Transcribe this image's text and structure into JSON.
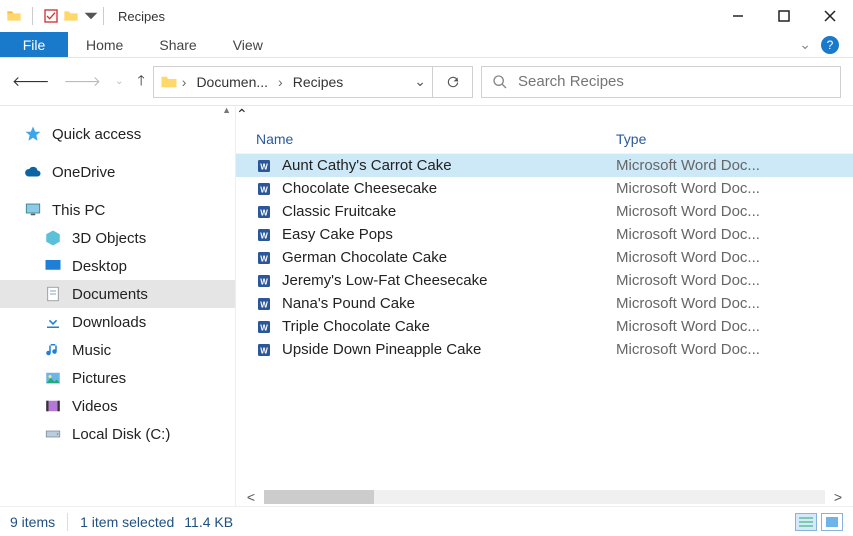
{
  "window": {
    "title": "Recipes"
  },
  "ribbon": {
    "file": "File",
    "tabs": [
      "Home",
      "Share",
      "View"
    ]
  },
  "address": {
    "segments": [
      "Documen...",
      "Recipes"
    ]
  },
  "search": {
    "placeholder": "Search Recipes"
  },
  "nav": {
    "quick_access": "Quick access",
    "onedrive": "OneDrive",
    "this_pc": "This PC",
    "items": [
      {
        "label": "3D Objects"
      },
      {
        "label": "Desktop"
      },
      {
        "label": "Documents"
      },
      {
        "label": "Downloads"
      },
      {
        "label": "Music"
      },
      {
        "label": "Pictures"
      },
      {
        "label": "Videos"
      },
      {
        "label": "Local Disk (C:)"
      }
    ]
  },
  "columns": {
    "name": "Name",
    "type": "Type"
  },
  "files": [
    {
      "name": "Aunt Cathy's Carrot Cake",
      "type": "Microsoft Word Doc...",
      "selected": true
    },
    {
      "name": "Chocolate Cheesecake",
      "type": "Microsoft Word Doc...",
      "selected": false
    },
    {
      "name": "Classic Fruitcake",
      "type": "Microsoft Word Doc...",
      "selected": false
    },
    {
      "name": "Easy Cake Pops",
      "type": "Microsoft Word Doc...",
      "selected": false
    },
    {
      "name": "German Chocolate Cake",
      "type": "Microsoft Word Doc...",
      "selected": false
    },
    {
      "name": "Jeremy's Low-Fat Cheesecake",
      "type": "Microsoft Word Doc...",
      "selected": false
    },
    {
      "name": "Nana's Pound Cake",
      "type": "Microsoft Word Doc...",
      "selected": false
    },
    {
      "name": "Triple Chocolate Cake",
      "type": "Microsoft Word Doc...",
      "selected": false
    },
    {
      "name": "Upside Down Pineapple Cake",
      "type": "Microsoft Word Doc...",
      "selected": false
    }
  ],
  "status": {
    "items": "9 items",
    "selected": "1 item selected",
    "size": "11.4 KB"
  }
}
